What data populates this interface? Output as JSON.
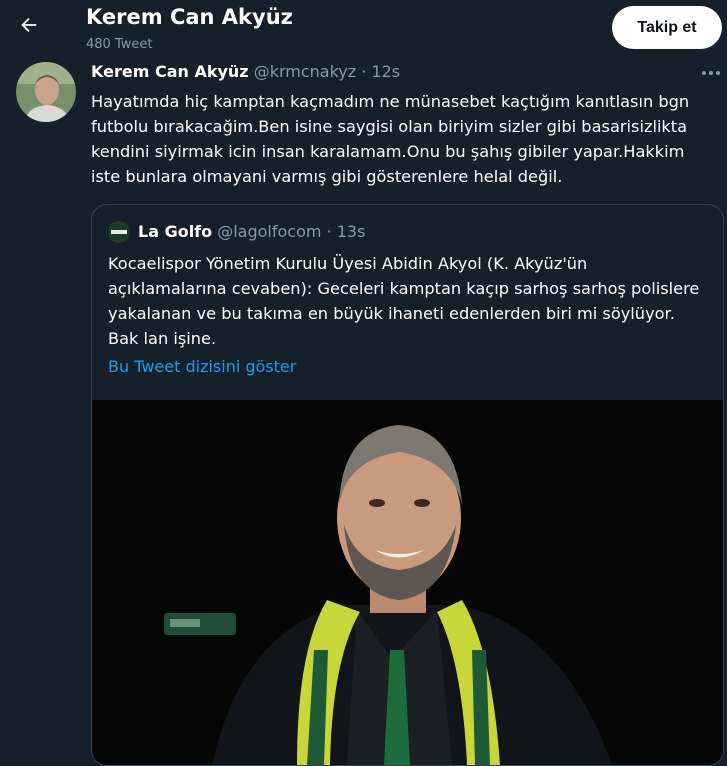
{
  "header": {
    "back_icon": "arrow-left-icon",
    "name": "Kerem Can Akyüz",
    "tweet_count": "480 Tweet",
    "follow_label": "Takip et"
  },
  "tweet": {
    "name": "Kerem Can Akyüz",
    "handle": "@krmcnakyz",
    "separator": "·",
    "time": "12s",
    "text": "Hayatımda hiç kamptan kaçmadım ne münasebet kaçtığım kanıtlasın bgn futbolu bırakacağim.Ben isine saygisi olan biriyim sizler gibi basarisizlikta kendini siyirmak icin insan karalamam.Onu bu şahış gibiler yapar.Hakkim iste bunlara olmayani varmış gibi gösterenlere helal değil.",
    "more_icon": "more-horizontal-icon"
  },
  "quote": {
    "logo_text": "LA GOLFO",
    "name": "La Golfo",
    "handle": "@lagolfocom",
    "separator": "·",
    "time": "13s",
    "text": "Kocaelispor Yönetim Kurulu Üyesi Abidin Akyol (K. Akyüz'ün açıklamalarına cevaben): Geceleri kamptan kaçıp sarhoş sarhoş polislere yakalanan ve bu takıma en büyük ihaneti edenlerden biri mi söylüyor. Bak lan işine.",
    "thread_link": "Bu Tweet dizisini göster"
  },
  "colors": {
    "background": "#15202b",
    "secondary_text": "#8899a6",
    "link": "#1d9bf0",
    "border": "#38444d"
  }
}
